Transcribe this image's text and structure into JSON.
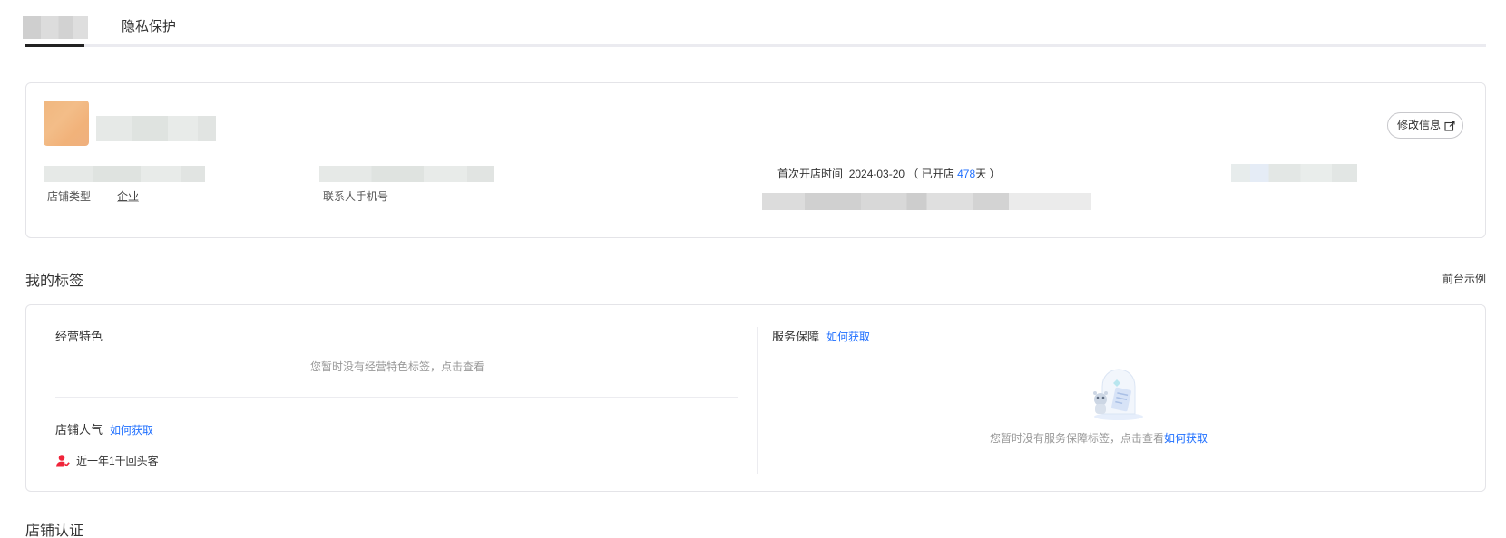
{
  "tabs": {
    "active_label_redacted": true,
    "privacy": "隐私保护"
  },
  "shop_info": {
    "edit_button": "修改信息",
    "open_time_label": "首次开店时间",
    "open_date": "2024-03-20",
    "open_prefix": "（ 已开店 ",
    "open_days": "478",
    "open_suffix": "天 ）",
    "shop_type_label": "店铺类型",
    "shop_type_value": "企业",
    "contact_phone_label": "联系人手机号"
  },
  "my_tags": {
    "title": "我的标签",
    "example_link": "前台示例",
    "business": {
      "title": "经营特色",
      "empty_text": "您暂时没有经营特色标签，点击查看"
    },
    "popularity": {
      "title": "店铺人气",
      "how_link": "如何获取",
      "item": "近一年1千回头客"
    },
    "service": {
      "title": "服务保障",
      "how_link": "如何获取",
      "empty_text": "您暂时没有服务保障标签，点击查看",
      "empty_link": "如何获取"
    }
  },
  "certification": {
    "title": "店铺认证"
  },
  "colors": {
    "link_blue": "#1f6fff",
    "icon_red": "#f0243a",
    "avatar_orange": "#f2b680"
  }
}
